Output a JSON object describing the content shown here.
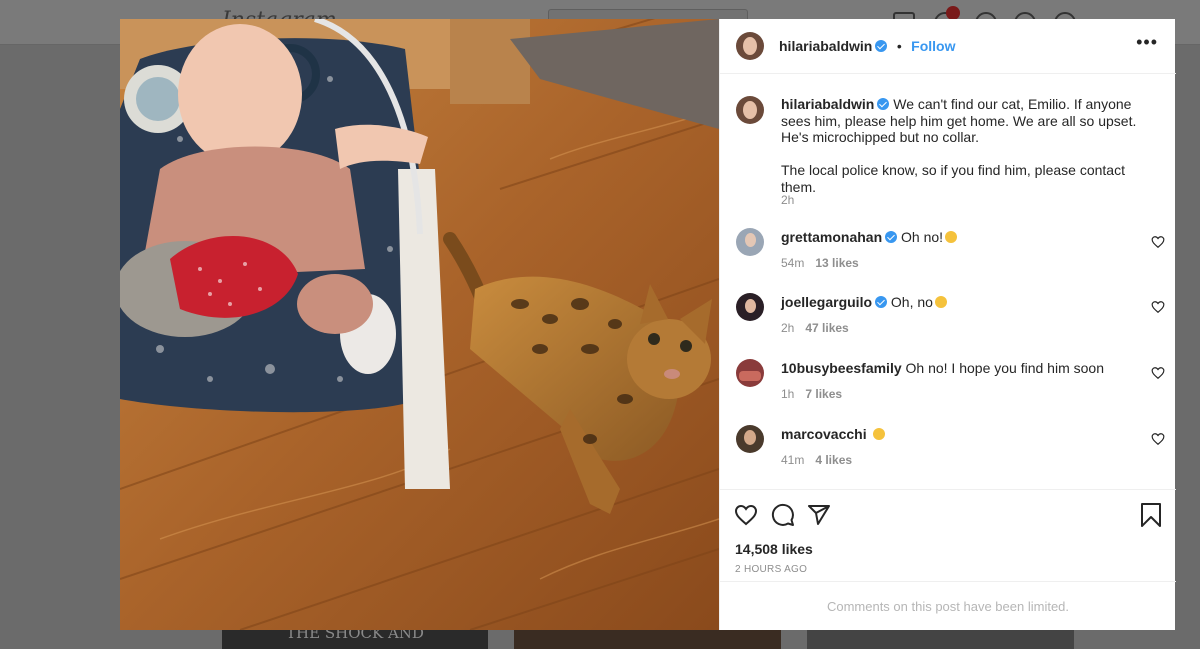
{
  "background": {
    "logo": "Instagram",
    "notification_count": "1",
    "tile_text": "THE SHOCK AND"
  },
  "post": {
    "author": "hilariabaldwin",
    "follow_label": "Follow",
    "more_icon": "more-dots-icon",
    "caption_line1": "We can't find our cat, Emilio. If anyone sees him, please help him get home. We are all so upset. He's microchipped but no collar.",
    "caption_line2": "The local police know, so if you find him, please contact them.",
    "caption_time": "2h",
    "likes": "14,508 likes",
    "posted_ago": "2 HOURS AGO",
    "comments_limited": "Comments on this post have been limited."
  },
  "comments": [
    {
      "user": "grettamonahan",
      "verified": true,
      "text": "Oh no!",
      "emoji": true,
      "time": "54m",
      "likes": "13 likes"
    },
    {
      "user": "joellegarguilo",
      "verified": true,
      "text": "Oh, no",
      "emoji": true,
      "time": "2h",
      "likes": "47 likes"
    },
    {
      "user": "10busybeesfamily",
      "verified": false,
      "text": "Oh no! I hope you find him soon",
      "emoji": false,
      "time": "1h",
      "likes": "7 likes"
    },
    {
      "user": "marcovacchi",
      "verified": false,
      "text": "",
      "emoji": true,
      "time": "41m",
      "likes": "4 likes"
    }
  ],
  "colors": {
    "accent": "#3897f0",
    "text": "#262626",
    "muted": "#8e8e8e"
  }
}
